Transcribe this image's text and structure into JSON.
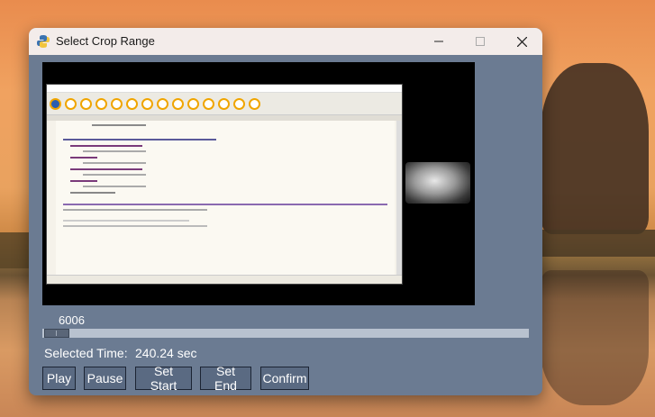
{
  "window": {
    "title": "Select Crop Range",
    "controls": [
      "minimize",
      "maximize",
      "close"
    ]
  },
  "video": {
    "frame_number": "6006"
  },
  "slider": {
    "position_fraction": 0.0
  },
  "selection": {
    "label": "Selected Time:",
    "value": "240.24 sec"
  },
  "buttons": {
    "play": "Play",
    "pause": "Pause",
    "set_start": "Set Start",
    "set_end": "Set End",
    "confirm": "Confirm"
  },
  "icons": {
    "app": "python-icon",
    "minimize": "minimize-icon",
    "maximize": "maximize-icon",
    "close": "close-icon"
  }
}
